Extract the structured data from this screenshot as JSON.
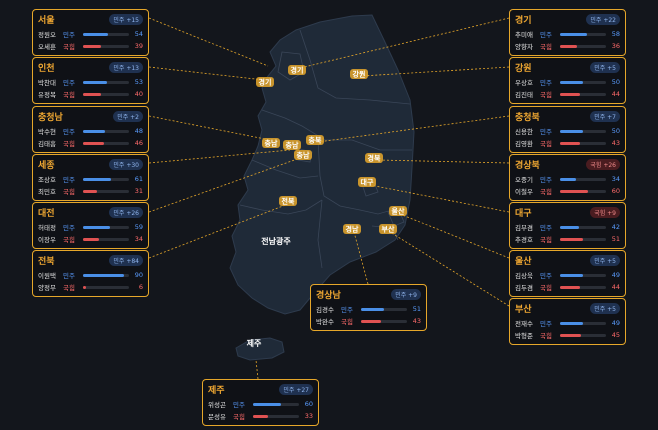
{
  "colors": {
    "accent": "#e6a72a",
    "democratic": "#4a8fe7",
    "ppp": "#e05252",
    "background": "#13161c",
    "land": "#1f2a38"
  },
  "party_labels": {
    "dm": "민주",
    "ppp": "국힘"
  },
  "map": {
    "markers": [
      "경기",
      "경기",
      "강원",
      "충남",
      "충남",
      "충북",
      "충남",
      "경북",
      "전북",
      "대구",
      "울산",
      "경남",
      "부산"
    ],
    "plain_labels": [
      "전남광주",
      "제주"
    ]
  },
  "cards": [
    {
      "region": "서울",
      "lead": "민주 +15",
      "lead_party": "dm",
      "rows": [
        {
          "name": "정원오",
          "party": "dm",
          "pct": 54
        },
        {
          "name": "오세훈",
          "party": "ppp",
          "pct": 39
        }
      ]
    },
    {
      "region": "인천",
      "lead": "민주 +13",
      "lead_party": "dm",
      "rows": [
        {
          "name": "박찬대",
          "party": "dm",
          "pct": 53
        },
        {
          "name": "유정복",
          "party": "ppp",
          "pct": 40
        }
      ]
    },
    {
      "region": "충청남",
      "lead": "민주 +2",
      "lead_party": "dm",
      "rows": [
        {
          "name": "박수현",
          "party": "dm",
          "pct": 48
        },
        {
          "name": "김태흠",
          "party": "ppp",
          "pct": 46
        }
      ]
    },
    {
      "region": "세종",
      "lead": "민주 +30",
      "lead_party": "dm",
      "rows": [
        {
          "name": "조상호",
          "party": "dm",
          "pct": 61
        },
        {
          "name": "최민호",
          "party": "ppp",
          "pct": 31
        }
      ]
    },
    {
      "region": "대전",
      "lead": "민주 +26",
      "lead_party": "dm",
      "rows": [
        {
          "name": "허태정",
          "party": "dm",
          "pct": 59
        },
        {
          "name": "이장우",
          "party": "ppp",
          "pct": 34
        }
      ]
    },
    {
      "region": "전북",
      "lead": "민주 +84",
      "lead_party": "dm",
      "rows": [
        {
          "name": "이원택",
          "party": "dm",
          "pct": 90
        },
        {
          "name": "양정무",
          "party": "ppp",
          "pct": 6
        }
      ]
    },
    {
      "region": "경기",
      "lead": "민주 +22",
      "lead_party": "dm",
      "rows": [
        {
          "name": "추미애",
          "party": "dm",
          "pct": 58
        },
        {
          "name": "양향자",
          "party": "ppp",
          "pct": 36
        }
      ]
    },
    {
      "region": "강원",
      "lead": "민주 +5",
      "lead_party": "dm",
      "rows": [
        {
          "name": "우상호",
          "party": "dm",
          "pct": 50
        },
        {
          "name": "김진태",
          "party": "ppp",
          "pct": 44
        }
      ]
    },
    {
      "region": "충청북",
      "lead": "민주 +7",
      "lead_party": "dm",
      "rows": [
        {
          "name": "신용한",
          "party": "dm",
          "pct": 50
        },
        {
          "name": "김영환",
          "party": "ppp",
          "pct": 43
        }
      ]
    },
    {
      "region": "경상북",
      "lead": "국힘 +26",
      "lead_party": "ppp",
      "rows": [
        {
          "name": "오중기",
          "party": "dm",
          "pct": 34
        },
        {
          "name": "이철우",
          "party": "ppp",
          "pct": 60
        }
      ]
    },
    {
      "region": "대구",
      "lead": "국힘 +9",
      "lead_party": "ppp",
      "rows": [
        {
          "name": "김부겸",
          "party": "dm",
          "pct": 42
        },
        {
          "name": "추경호",
          "party": "ppp",
          "pct": 51
        }
      ]
    },
    {
      "region": "울산",
      "lead": "민주 +5",
      "lead_party": "dm",
      "rows": [
        {
          "name": "김상욱",
          "party": "dm",
          "pct": 49
        },
        {
          "name": "김두겸",
          "party": "ppp",
          "pct": 44
        }
      ]
    },
    {
      "region": "부산",
      "lead": "민주 +5",
      "lead_party": "dm",
      "rows": [
        {
          "name": "전재수",
          "party": "dm",
          "pct": 49
        },
        {
          "name": "박형준",
          "party": "ppp",
          "pct": 45
        }
      ]
    },
    {
      "region": "경상남",
      "lead": "민주 +9",
      "lead_party": "dm",
      "rows": [
        {
          "name": "김경수",
          "party": "dm",
          "pct": 51
        },
        {
          "name": "박완수",
          "party": "ppp",
          "pct": 43
        }
      ]
    },
    {
      "region": "제주",
      "lead": "민주 +27",
      "lead_party": "dm",
      "rows": [
        {
          "name": "위성곤",
          "party": "dm",
          "pct": 60
        },
        {
          "name": "문성유",
          "party": "ppp",
          "pct": 33
        }
      ]
    }
  ]
}
